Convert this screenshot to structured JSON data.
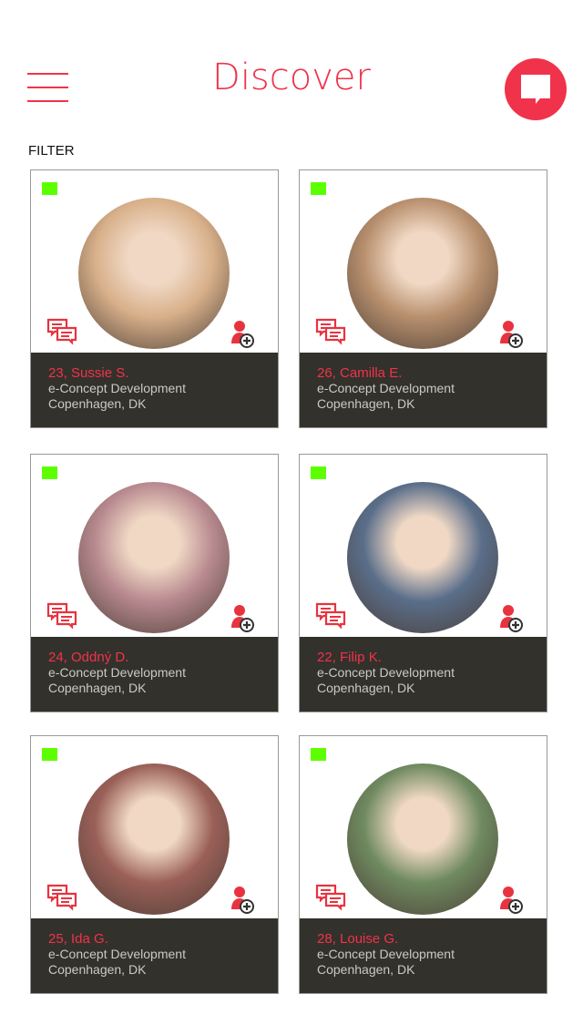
{
  "header": {
    "title": "Discover",
    "filter_label": "FILTER"
  },
  "colors": {
    "accent": "#f0334a",
    "card_footer": "#33312b",
    "online": "#5dff00"
  },
  "profiles": [
    {
      "name": "23, Sussie S.",
      "company": "e-Concept Development",
      "location": "Copenhagen, DK",
      "avatar": "#d8b08a"
    },
    {
      "name": "26, Camilla E.",
      "company": "e-Concept Development",
      "location": "Copenhagen, DK",
      "avatar": "#b8906e"
    },
    {
      "name": "24, Oddný D.",
      "company": "e-Concept Development",
      "location": "Copenhagen, DK",
      "avatar": "#b88a90"
    },
    {
      "name": "22, Filip K.",
      "company": "e-Concept Development",
      "location": "Copenhagen, DK",
      "avatar": "#5a6e8a"
    },
    {
      "name": "25, Ida G.",
      "company": "e-Concept Development",
      "location": "Copenhagen, DK",
      "avatar": "#9a6058"
    },
    {
      "name": "28, Louise G.",
      "company": "e-Concept Development",
      "location": "Copenhagen, DK",
      "avatar": "#6f8a60"
    }
  ]
}
